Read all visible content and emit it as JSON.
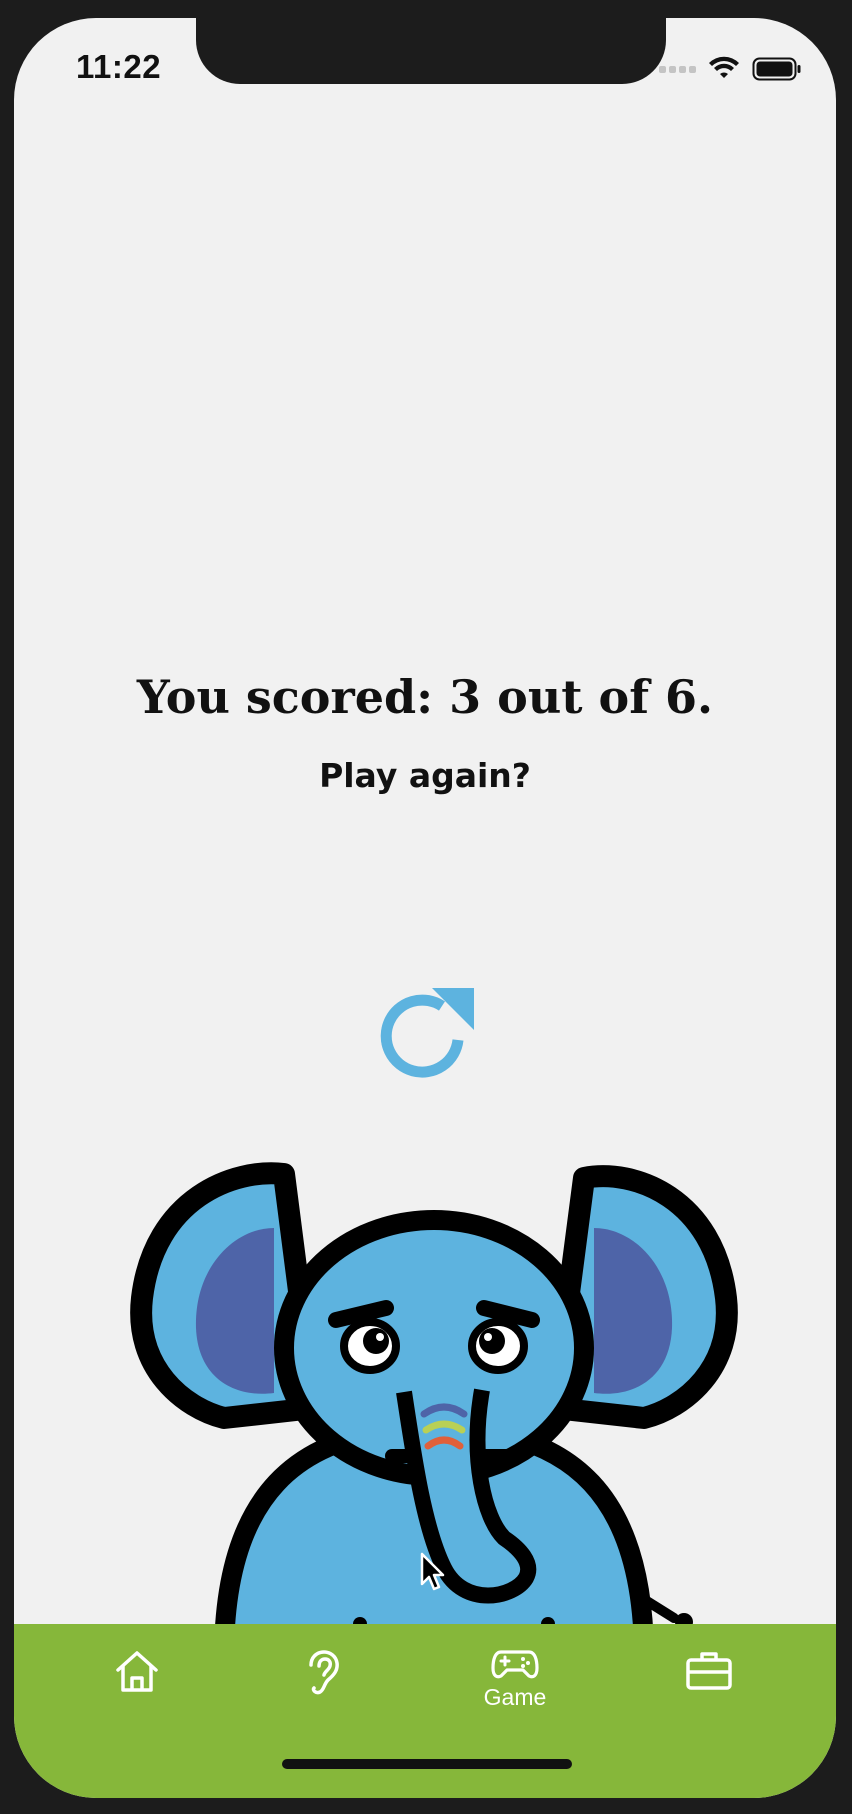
{
  "status_bar": {
    "time": "11:22"
  },
  "result": {
    "score_text": "You scored: 3 out of 6.",
    "prompt": "Play again?"
  },
  "icons": {
    "replay": "replay-icon",
    "mascot": "elephant-mascot"
  },
  "tab_bar": {
    "tabs": [
      {
        "icon": "home-icon",
        "label": ""
      },
      {
        "icon": "ear-icon",
        "label": ""
      },
      {
        "icon": "gamepad-icon",
        "label": "Game"
      },
      {
        "icon": "briefcase-icon",
        "label": ""
      }
    ]
  },
  "colors": {
    "accent_blue": "#5db3df",
    "tab_green": "#86b73a",
    "ear_inner": "#4e64a8",
    "background": "#f1f1f1"
  }
}
